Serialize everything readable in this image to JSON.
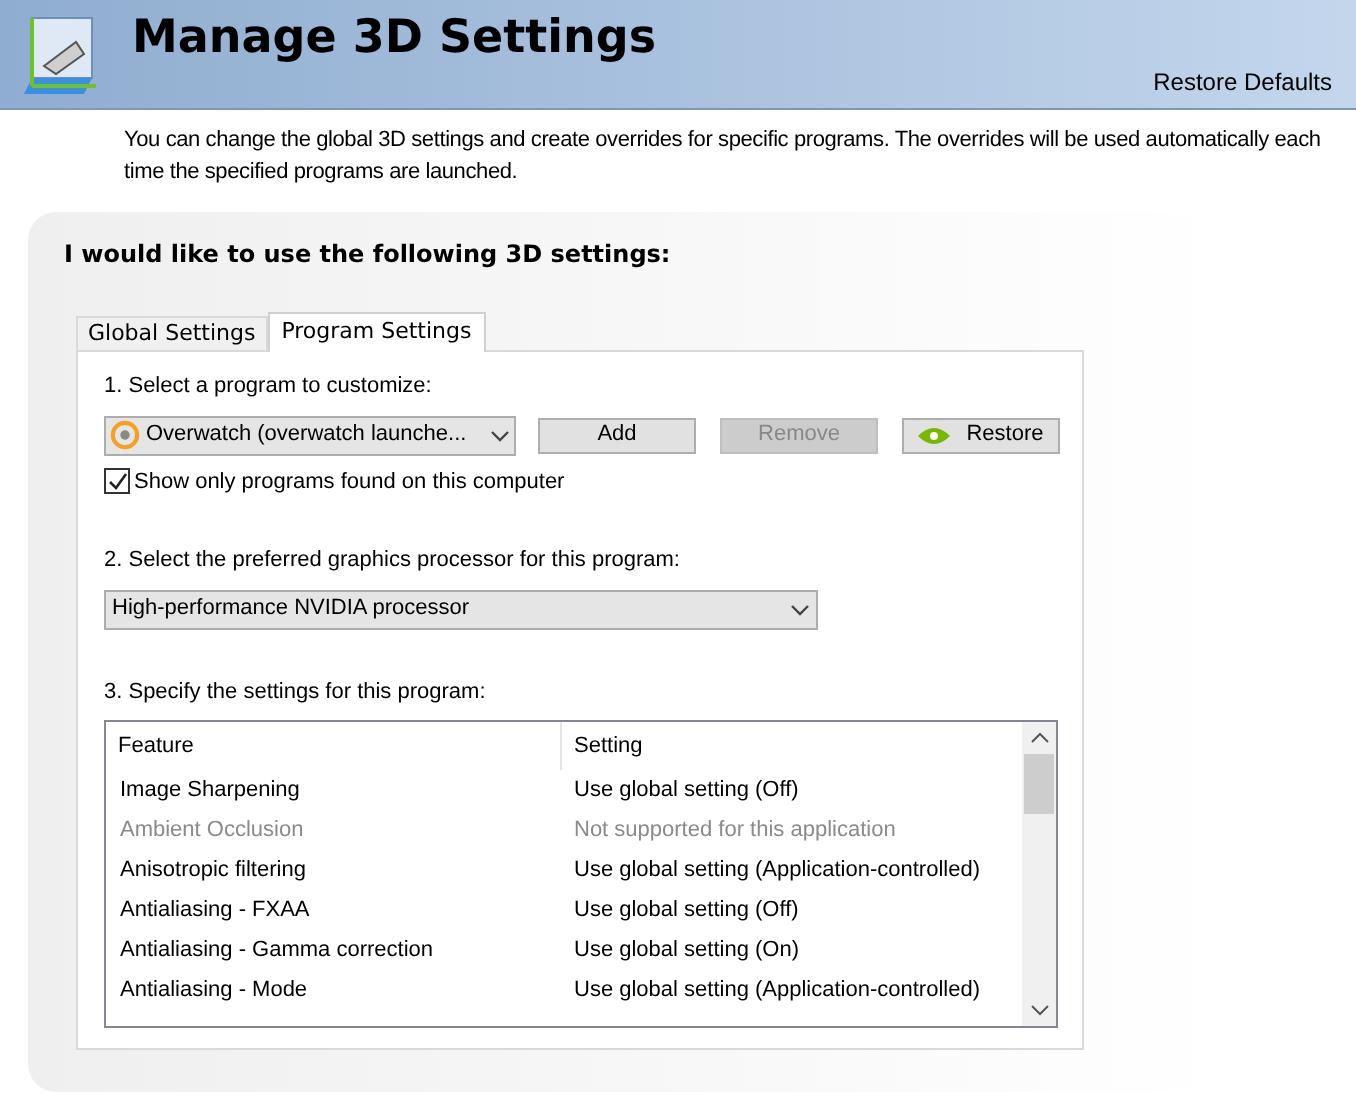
{
  "header": {
    "title": "Manage 3D Settings",
    "restore_link": "Restore Defaults"
  },
  "description": "You can change the global 3D settings and create overrides for specific programs. The overrides will be used automatically each time the specified programs are launched.",
  "panel": {
    "heading": "I would like to use the following 3D settings:",
    "tabs": [
      {
        "label": "Global Settings",
        "selected": false
      },
      {
        "label": "Program Settings",
        "selected": true
      }
    ],
    "step1": {
      "label": "1. Select a program to customize:",
      "program": "Overwatch (overwatch launche...",
      "buttons": [
        {
          "label": "Add",
          "disabled": false
        },
        {
          "label": "Remove",
          "disabled": true
        },
        {
          "label": "Restore",
          "disabled": false
        }
      ],
      "show_only_found": {
        "label": "Show only programs found on this computer",
        "checked": true
      }
    },
    "step2": {
      "label": "2. Select the preferred graphics processor for this program:",
      "value": "High-performance NVIDIA processor"
    },
    "step3": {
      "label": "3. Specify the settings for this program:",
      "columns": [
        "Feature",
        "Setting"
      ],
      "rows": [
        {
          "feature": "Image Sharpening",
          "setting": "Use global setting (Off)",
          "disabled": false
        },
        {
          "feature": "Ambient Occlusion",
          "setting": "Not supported for this application",
          "disabled": true
        },
        {
          "feature": "Anisotropic filtering",
          "setting": "Use global setting (Application-controlled)",
          "disabled": false
        },
        {
          "feature": "Antialiasing - FXAA",
          "setting": "Use global setting (Off)",
          "disabled": false
        },
        {
          "feature": "Antialiasing - Gamma correction",
          "setting": "Use global setting (On)",
          "disabled": false
        },
        {
          "feature": "Antialiasing - Mode",
          "setting": "Use global setting (Application-controlled)",
          "disabled": false
        }
      ]
    }
  }
}
